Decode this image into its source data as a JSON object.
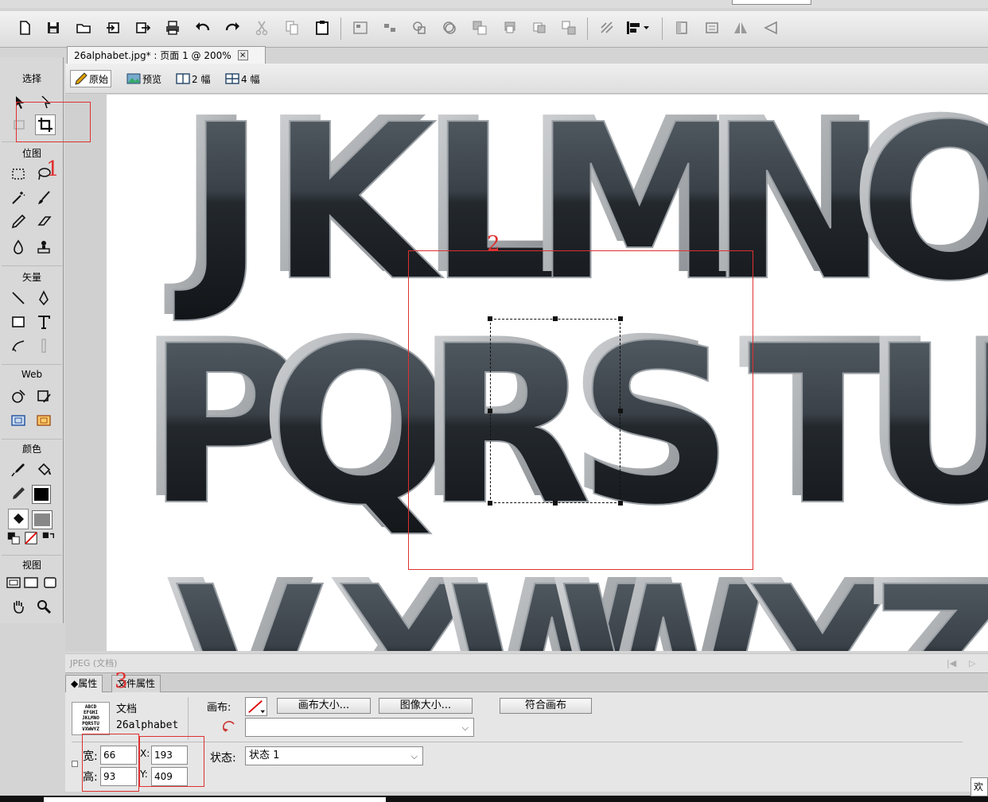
{
  "document": {
    "tab_title": "26alphabet.jpg* : 页面 1 @ 200%",
    "close_glyph": "×"
  },
  "view_tabs": [
    {
      "label": "原始",
      "icon": "pencil-icon"
    },
    {
      "label": "预览",
      "icon": "image-icon"
    },
    {
      "label": "2 幅",
      "icon": "two-panel-icon"
    },
    {
      "label": "4 幅",
      "icon": "four-panel-icon"
    }
  ],
  "tools": {
    "sections": {
      "select": "选择",
      "bitmap": "位图",
      "vector": "矢量",
      "web": "Web",
      "color": "颜色",
      "view": "视图"
    }
  },
  "canvas": {
    "letters_row1": [
      "J",
      "K",
      "L",
      "M",
      "N",
      "O"
    ],
    "letters_row2": [
      "P",
      "Q",
      "R",
      "S",
      "T",
      "U"
    ],
    "letters_row3": [
      "V",
      "X",
      "W",
      "W",
      "Y",
      "Z"
    ]
  },
  "status": {
    "left": "JPEG (文档)",
    "nav_first": "|◀",
    "nav_next": "▷"
  },
  "properties": {
    "tab_props": "◆属性",
    "tab_doc": "文件属性",
    "doc_label": "文档",
    "doc_name": "26alphabet",
    "thumb_rows": [
      "ABCD",
      "EFGHI",
      "JKLMNO",
      "PQRSTU",
      "VXWWYZ"
    ],
    "canvas_label": "画布:",
    "canvas_size_btn": "画布大小...",
    "image_size_btn": "图像大小...",
    "fit_canvas_btn": "符合画布",
    "width_label": "宽:",
    "width_value": "66",
    "height_label": "高:",
    "height_value": "93",
    "x_label": "X:",
    "x_value": "193",
    "y_label": "Y:",
    "y_value": "409",
    "state_label": "状态:",
    "state_value": "状态 1"
  },
  "annotations": {
    "n1": "1",
    "n2": "2",
    "n3": "3"
  },
  "corner_text": "欢",
  "colors": {
    "annotation_red": "#e03030",
    "letter_face": "#3a4148",
    "letter_side": "#a8abae"
  }
}
